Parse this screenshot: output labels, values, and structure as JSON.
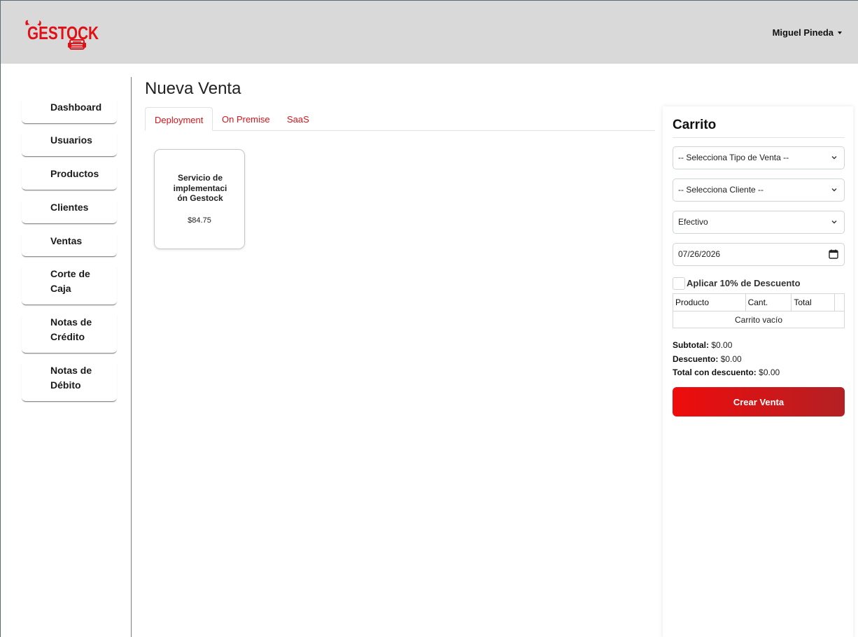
{
  "header": {
    "logo_text": "GESTOCK",
    "user_name": "Miguel Pineda"
  },
  "sidebar": {
    "items": [
      {
        "label": "Dashboard",
        "lines": [
          "Dashboard"
        ]
      },
      {
        "label": "Usuarios",
        "lines": [
          "Usuarios"
        ]
      },
      {
        "label": "Productos",
        "lines": [
          "Productos"
        ]
      },
      {
        "label": "Clientes",
        "lines": [
          "Clientes"
        ]
      },
      {
        "label": "Ventas",
        "lines": [
          "Ventas"
        ]
      },
      {
        "label": "Corte de Caja",
        "lines": [
          "Corte de",
          "Caja"
        ]
      },
      {
        "label": "Notas de Crédito",
        "lines": [
          "Notas de",
          "Crédito"
        ]
      },
      {
        "label": "Notas de Débito",
        "lines": [
          "Notas de",
          "Débito"
        ]
      }
    ]
  },
  "main": {
    "title": "Nueva Venta",
    "tabs": [
      {
        "label": "Deployment",
        "active": true
      },
      {
        "label": "On Premise",
        "active": false
      },
      {
        "label": "SaaS",
        "active": false
      }
    ],
    "products": [
      {
        "name": "Servicio de implementación Gestock",
        "price": "$84.75"
      }
    ]
  },
  "cart": {
    "title": "Carrito",
    "sale_type": "-- Selecciona Tipo de Venta --",
    "client": "-- Selecciona Cliente --",
    "payment_method": "Efectivo",
    "date": "07/26/2026",
    "discount_label": "Aplicar 10% de Descuento",
    "discount_checked": false,
    "table": {
      "headers": [
        "Producto",
        "Cant.",
        "Total"
      ],
      "empty": "Carrito vacío"
    },
    "subtotal_label": "Subtotal:",
    "subtotal": "$0.00",
    "discount_amount_label": "Descuento:",
    "discount_amount": "$0.00",
    "total_label": "Total con descuento:",
    "total": "$0.00",
    "create_button": "Crear Venta"
  },
  "colors": {
    "accent": "#d9131a",
    "header_bg": "#d9d9d9",
    "button_gradient_start": "#ef0c0c",
    "button_gradient_end": "#b32024"
  }
}
